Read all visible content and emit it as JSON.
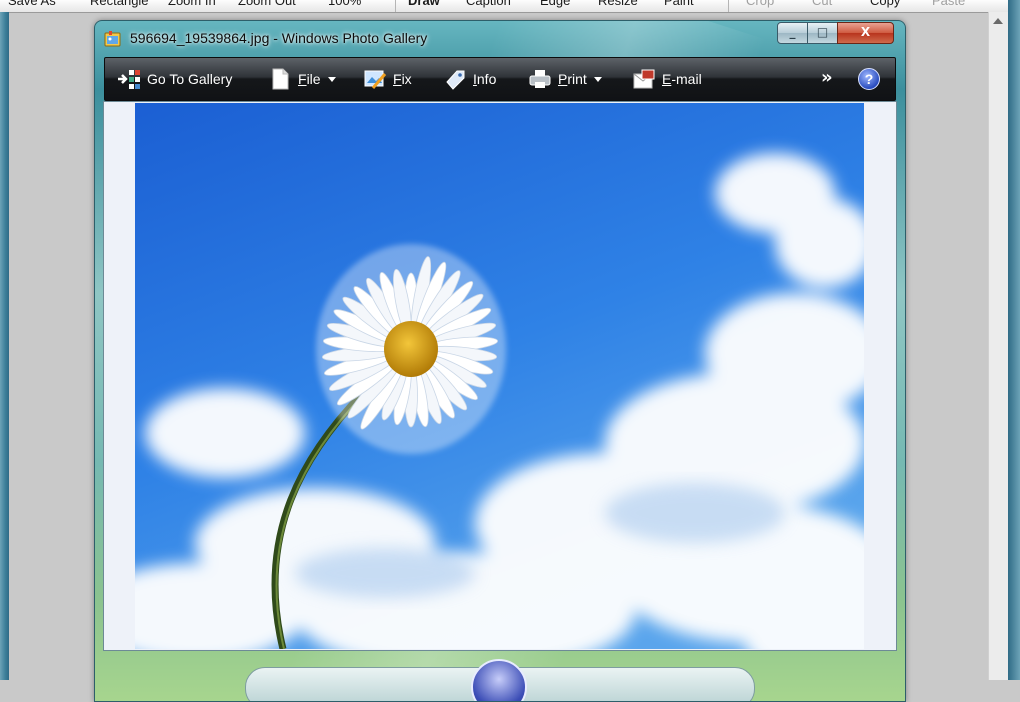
{
  "host_app": {
    "toolbar_items": [
      {
        "label": "Save As",
        "style": "normal"
      },
      {
        "label": "Rectangle",
        "style": "normal"
      },
      {
        "label": "Zoom In",
        "style": "normal"
      },
      {
        "label": "Zoom Out",
        "style": "normal"
      },
      {
        "label": "100%",
        "style": "normal"
      },
      {
        "label": "Draw",
        "style": "bold"
      },
      {
        "label": "Caption",
        "style": "normal"
      },
      {
        "label": "Edge",
        "style": "normal"
      },
      {
        "label": "Resize",
        "style": "normal"
      },
      {
        "label": "Paint",
        "style": "normal"
      },
      {
        "label": "Crop",
        "style": "dim"
      },
      {
        "label": "Cut",
        "style": "dim"
      },
      {
        "label": "Copy",
        "style": "normal"
      },
      {
        "label": "Paste",
        "style": "dim"
      }
    ]
  },
  "window": {
    "title": "596694_19539864.jpg - Windows Photo Gallery",
    "icon": "photo-gallery-app-icon",
    "caption_buttons": {
      "minimize": "_",
      "maximize": "□",
      "close": "X"
    }
  },
  "command_bar": {
    "items": [
      {
        "label": "Go To Gallery",
        "icon": "go-to-gallery-icon",
        "underline_index": -1,
        "has_arrow": false
      },
      {
        "label": "File",
        "icon": "file-icon",
        "underline_index": 0,
        "has_arrow": true
      },
      {
        "label": "Fix",
        "icon": "fix-icon",
        "underline_index": 0,
        "has_arrow": false
      },
      {
        "label": "Info",
        "icon": "info-tag-icon",
        "underline_index": 0,
        "has_arrow": false
      },
      {
        "label": "Print",
        "icon": "printer-icon",
        "underline_index": 0,
        "has_arrow": true
      },
      {
        "label": "E-mail",
        "icon": "email-icon",
        "underline_index": 0,
        "has_arrow": false
      }
    ],
    "more_glyph": "»",
    "help_glyph": "?"
  },
  "photo": {
    "subject": "white daisy against blue sky with clouds",
    "sky_color": "#1d64d6",
    "petal_color": "#ffffff",
    "center_color": "#e0a90c"
  },
  "colors": {
    "command_bar_dark": "#15171a",
    "window_glass": "#3c8f9d"
  }
}
